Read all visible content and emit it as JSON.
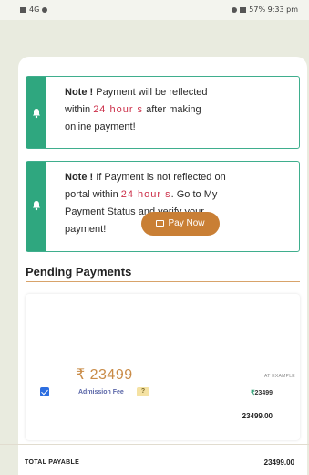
{
  "statusbar": {
    "left": "4G",
    "right": "57% 9:33 pm"
  },
  "notes": [
    {
      "prefix": "Note !",
      "line1": "Payment will be reflected",
      "line2_pre": "within",
      "line2_hl": "24 hour s",
      "line2_post": "after making",
      "line3": "online payment!"
    },
    {
      "prefix": "Note !",
      "line1": "If Payment is not reflected on",
      "line2_pre": "portal within",
      "line2_hl": "24 hour s",
      "line2_post": ". Go to My",
      "line3": "Payment Status and verify your",
      "line4": "payment!"
    }
  ],
  "pending": {
    "title": "Pending Payments",
    "amount": "₹ 23499",
    "fee_label": "Admission Fee",
    "fee_badge": "?",
    "caption": "AT EXAMPLE",
    "side_symbol": "₹",
    "side_amount": "23499",
    "side_total": "23499.00",
    "pay_button": "Pay Now"
  },
  "footer": {
    "total_label": "TOTAL PAYABLE",
    "total_value": "23499.00"
  }
}
